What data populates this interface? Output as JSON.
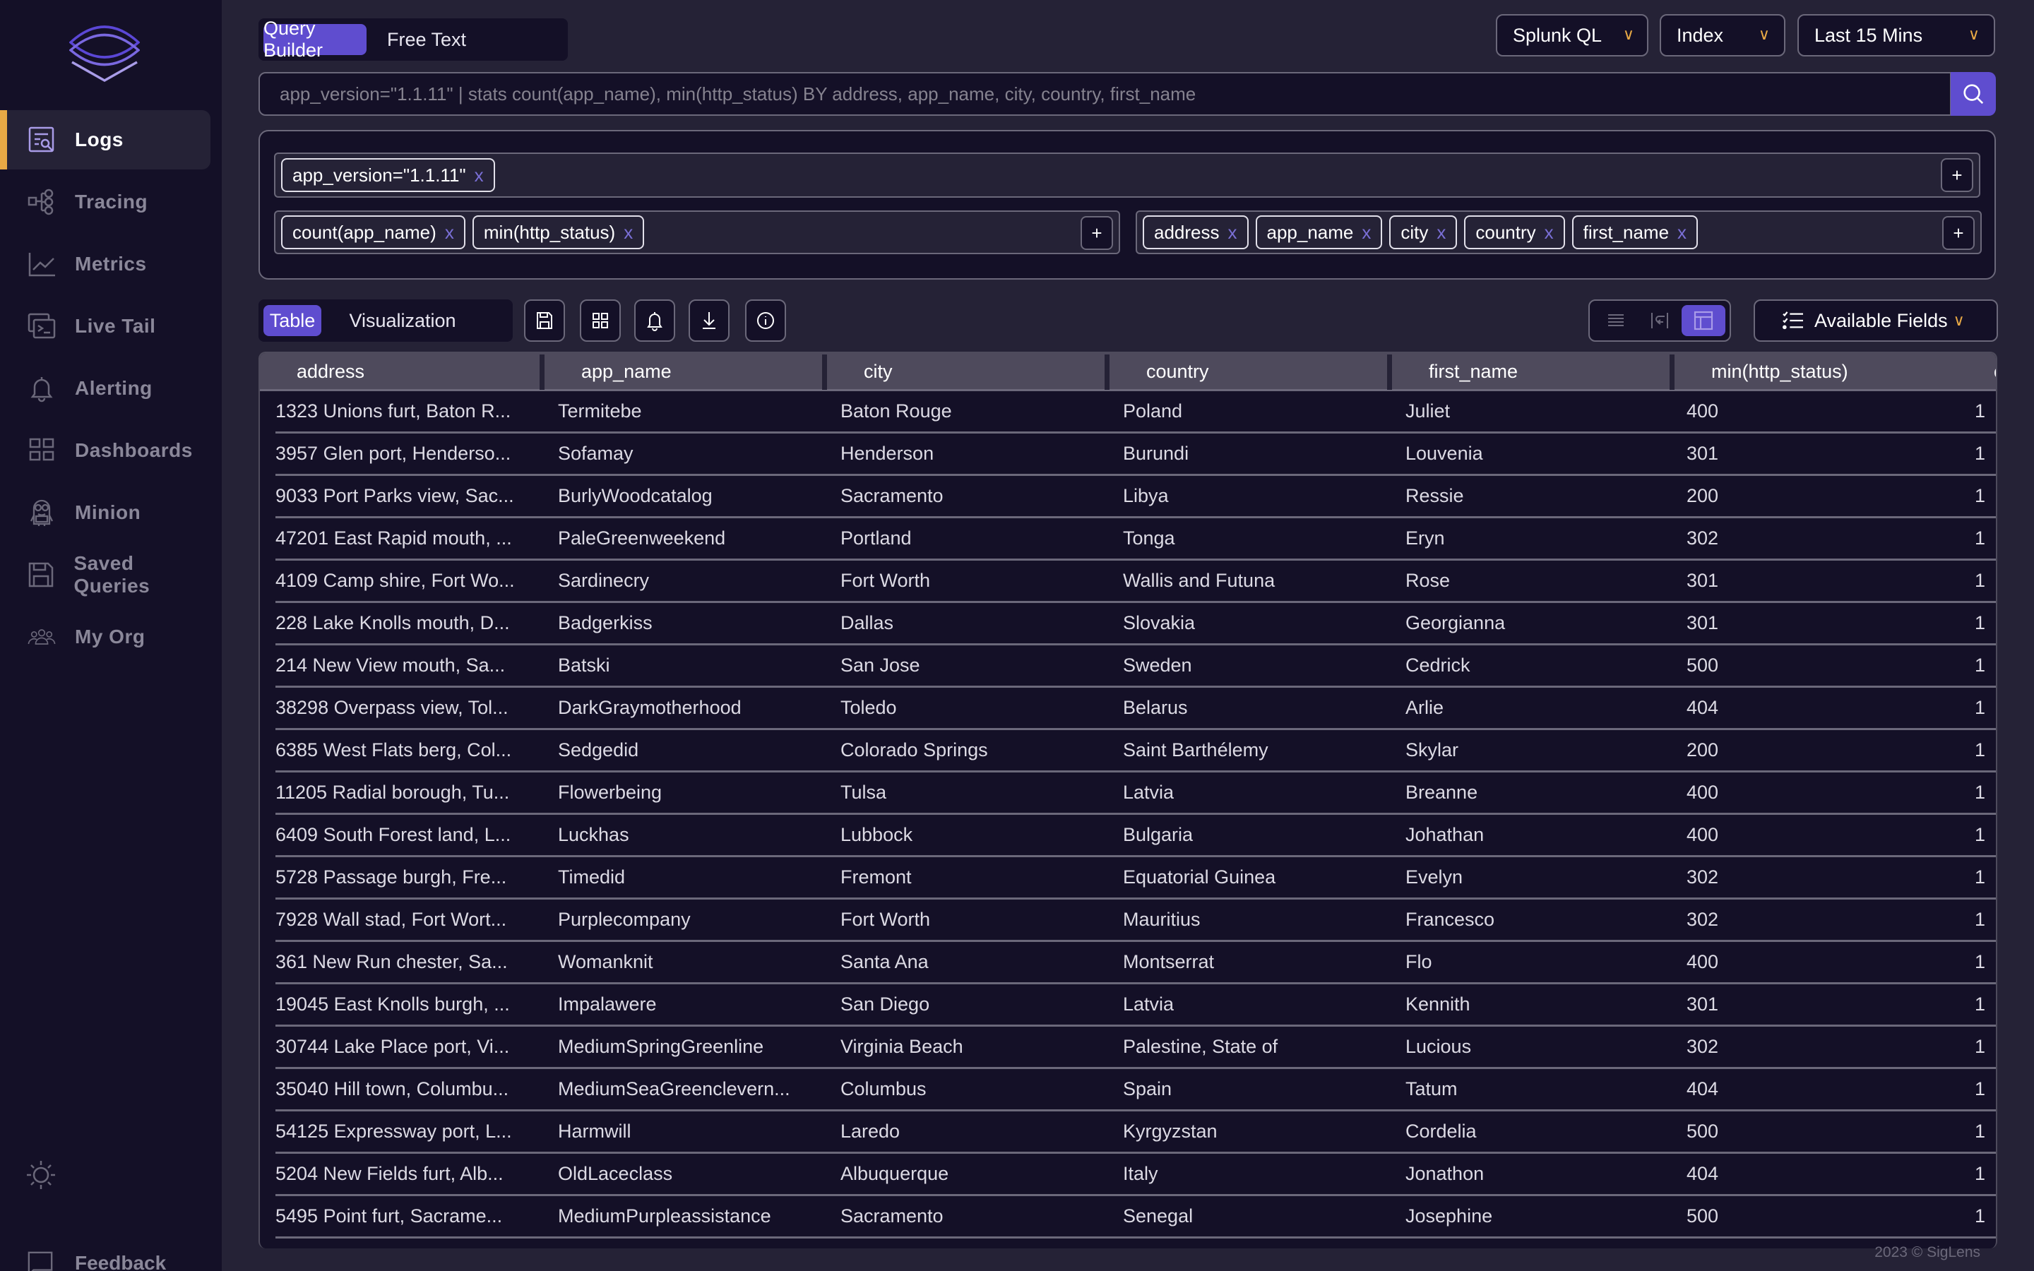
{
  "sidebar": {
    "logo": "siglens-logo",
    "items": [
      {
        "label": "Logs",
        "icon": "logs-search-icon",
        "active": true
      },
      {
        "label": "Tracing",
        "icon": "tracing-icon"
      },
      {
        "label": "Metrics",
        "icon": "metrics-chart-icon"
      },
      {
        "label": "Live Tail",
        "icon": "terminal-icon"
      },
      {
        "label": "Alerting",
        "icon": "bell-icon"
      },
      {
        "label": "Dashboards",
        "icon": "dashboard-grid-icon"
      },
      {
        "label": "Minion",
        "icon": "minion-icon"
      },
      {
        "label": "Saved Queries",
        "icon": "save-icon"
      },
      {
        "label": "My Org",
        "icon": "users-icon"
      }
    ],
    "theme_toggle_icon": "sun-icon",
    "feedback_label": "Feedback"
  },
  "header": {
    "mode_tabs": [
      "Query Builder",
      "Free Text"
    ],
    "active_mode": "Query Builder",
    "query_language": "Splunk QL",
    "index": "Index",
    "time_range": "Last 15 Mins",
    "search_value": "app_version=\"1.1.11\" | stats count(app_name), min(http_status) BY address, app_name, city, country, first_name",
    "search_button_icon": "search-icon"
  },
  "query_builder": {
    "filters": [
      "app_version=\"1.1.11\""
    ],
    "aggregations": [
      "count(app_name)",
      "min(http_status)"
    ],
    "group_by": [
      "address",
      "app_name",
      "city",
      "country",
      "first_name"
    ],
    "remove_label": "x",
    "add_label": "+"
  },
  "results_toolbar": {
    "view_tabs": [
      "Table",
      "Visualization"
    ],
    "active_view": "Table",
    "actions": [
      "save-query",
      "add-to-dashboard",
      "create-alert",
      "download",
      "info"
    ],
    "layout_options": [
      "single-line",
      "wrap-lines",
      "table-view"
    ],
    "active_layout": "table-view",
    "available_fields_label": "Available Fields"
  },
  "table": {
    "columns": [
      "address",
      "app_name",
      "city",
      "country",
      "first_name",
      "min(http_status)",
      "count(app_name)"
    ],
    "rows": [
      [
        "1323 Unions furt, Baton R...",
        "Termitebe",
        "Baton Rouge",
        "Poland",
        "Juliet",
        "400",
        "1"
      ],
      [
        "3957 Glen port, Henderso...",
        "Sofamay",
        "Henderson",
        "Burundi",
        "Louvenia",
        "301",
        "1"
      ],
      [
        "9033 Port Parks view, Sac...",
        "BurlyWoodcatalog",
        "Sacramento",
        "Libya",
        "Ressie",
        "200",
        "1"
      ],
      [
        "47201 East Rapid mouth, ...",
        "PaleGreenweekend",
        "Portland",
        "Tonga",
        "Eryn",
        "302",
        "1"
      ],
      [
        "4109 Camp shire, Fort Wo...",
        "Sardinecry",
        "Fort Worth",
        "Wallis and Futuna",
        "Rose",
        "301",
        "1"
      ],
      [
        "228 Lake Knolls mouth, D...",
        "Badgerkiss",
        "Dallas",
        "Slovakia",
        "Georgianna",
        "301",
        "1"
      ],
      [
        "214 New View mouth, Sa...",
        "Batski",
        "San Jose",
        "Sweden",
        "Cedrick",
        "500",
        "1"
      ],
      [
        "38298 Overpass view, Tol...",
        "DarkGraymotherhood",
        "Toledo",
        "Belarus",
        "Arlie",
        "404",
        "1"
      ],
      [
        "6385 West Flats berg, Col...",
        "Sedgedid",
        "Colorado Springs",
        "Saint Barthélemy",
        "Skylar",
        "200",
        "1"
      ],
      [
        "11205 Radial borough, Tu...",
        "Flowerbeing",
        "Tulsa",
        "Latvia",
        "Breanne",
        "400",
        "1"
      ],
      [
        "6409 South Forest land, L...",
        "Luckhas",
        "Lubbock",
        "Bulgaria",
        "Johathan",
        "400",
        "1"
      ],
      [
        "5728 Passage burgh, Fre...",
        "Timedid",
        "Fremont",
        "Equatorial Guinea",
        "Evelyn",
        "302",
        "1"
      ],
      [
        "7928 Wall stad, Fort Wort...",
        "Purplecompany",
        "Fort Worth",
        "Mauritius",
        "Francesco",
        "302",
        "1"
      ],
      [
        "361 New Run chester, Sa...",
        "Womanknit",
        "Santa Ana",
        "Montserrat",
        "Flo",
        "400",
        "1"
      ],
      [
        "19045 East Knolls burgh, ...",
        "Impalawere",
        "San Diego",
        "Latvia",
        "Kennith",
        "301",
        "1"
      ],
      [
        "30744 Lake Place port, Vi...",
        "MediumSpringGreenline",
        "Virginia Beach",
        "Palestine, State of",
        "Lucious",
        "302",
        "1"
      ],
      [
        "35040 Hill town, Columbu...",
        "MediumSeaGreenclevern...",
        "Columbus",
        "Spain",
        "Tatum",
        "404",
        "1"
      ],
      [
        "54125 Expressway port, L...",
        "Harmwill",
        "Laredo",
        "Kyrgyzstan",
        "Cordelia",
        "500",
        "1"
      ],
      [
        "5204 New Fields furt, Alb...",
        "OldLaceclass",
        "Albuquerque",
        "Italy",
        "Jonathon",
        "404",
        "1"
      ],
      [
        "5495 Point furt, Sacrame...",
        "MediumPurpleassistance",
        "Sacramento",
        "Senegal",
        "Josephine",
        "500",
        "1"
      ]
    ]
  },
  "footer": {
    "copyright": "2023 © SigLens"
  },
  "colors": {
    "accent": "#5f4dcf",
    "active_indicator": "#e8a945",
    "sidebar_bg": "#141027",
    "page_bg": "#252236"
  }
}
